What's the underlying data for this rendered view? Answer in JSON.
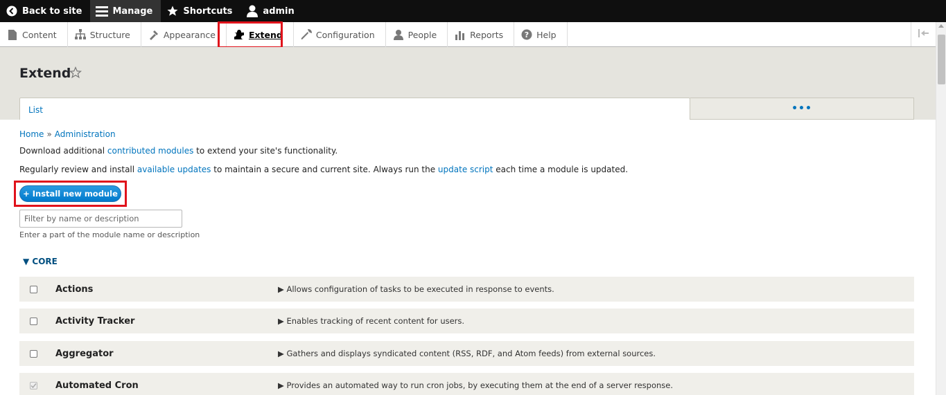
{
  "toolbar": {
    "back_to_site": "Back to site",
    "manage": "Manage",
    "shortcuts": "Shortcuts",
    "user": "admin"
  },
  "tray": {
    "items": [
      {
        "label": "Content",
        "icon": "content-icon"
      },
      {
        "label": "Structure",
        "icon": "structure-icon"
      },
      {
        "label": "Appearance",
        "icon": "appearance-icon"
      },
      {
        "label": "Extend",
        "icon": "puzzle-icon"
      },
      {
        "label": "Configuration",
        "icon": "wrench-icon"
      },
      {
        "label": "People",
        "icon": "people-icon"
      },
      {
        "label": "Reports",
        "icon": "reports-icon"
      },
      {
        "label": "Help",
        "icon": "help-icon"
      }
    ]
  },
  "page": {
    "title": "Extend",
    "tabs": {
      "list": "List",
      "more": "•••"
    },
    "breadcrumb": {
      "home": "Home",
      "sep": "»",
      "admin": "Administration"
    }
  },
  "help": {
    "line1_pre": "Download additional ",
    "line1_link": "contributed modules",
    "line1_post": " to extend your site's functionality.",
    "line2_pre": "Regularly review and install ",
    "line2_link1": "available updates",
    "line2_mid": " to maintain a secure and current site. Always run the ",
    "line2_link2": "update script",
    "line2_post": " each time a module is updated."
  },
  "install_button": "+ Install new module",
  "filter": {
    "placeholder": "Filter by name or description",
    "description": "Enter a part of the module name or description"
  },
  "core_label": "▼ CORE",
  "modules": [
    {
      "name": "Actions",
      "description": "▶ Allows configuration of tasks to be executed in response to events."
    },
    {
      "name": "Activity Tracker",
      "description": "▶ Enables tracking of recent content for users."
    },
    {
      "name": "Aggregator",
      "description": "▶ Gathers and displays syndicated content (RSS, RDF, and Atom feeds) from external sources."
    },
    {
      "name": "Automated Cron",
      "description": "▶ Provides an automated way to run cron jobs, by executing them at the end of a server response."
    }
  ]
}
